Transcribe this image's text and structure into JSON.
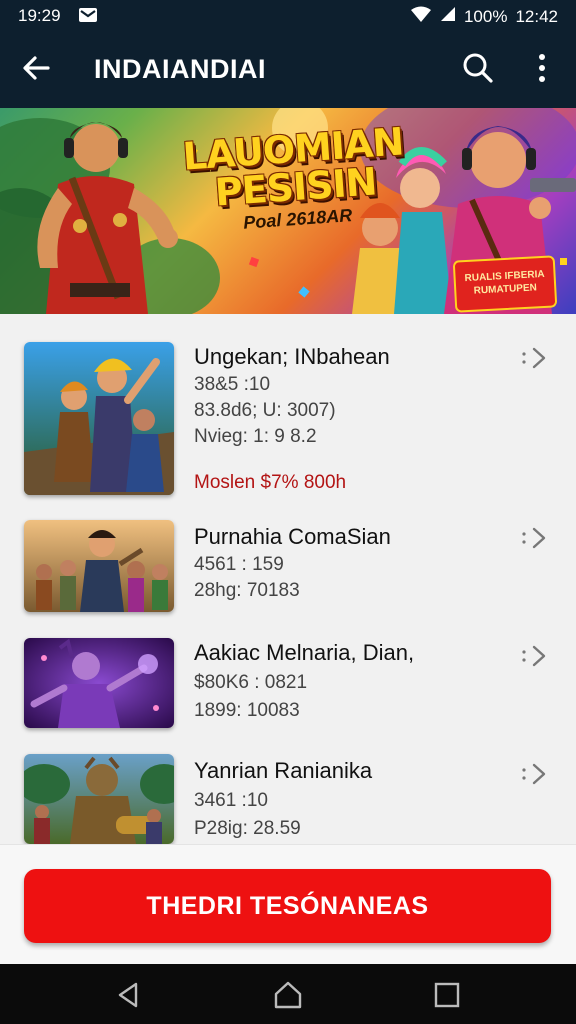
{
  "status_bar": {
    "time_left": "19:29",
    "battery": "100%",
    "time_right": "12:42"
  },
  "app_bar": {
    "title": "INDAIANDIAI"
  },
  "banner": {
    "headline_line1": "LAUOMIAN",
    "headline_line2": "PESISIN",
    "subtitle": "Poal 2618AR",
    "badge_line1": "RUALIS IFBERIA",
    "badge_line2": "RUMATUPEN"
  },
  "games": [
    {
      "name": "Ungekan; INbahean",
      "meta": [
        "38&5 :10",
        "83.8d6; U: 3007)",
        "Nvieg: 1: 9 8.2"
      ],
      "promo": "Moslen $7% 800h",
      "art": "heroes"
    },
    {
      "name": "Purnahia ComaSian",
      "meta": [
        "4561 : 159",
        "28hg: 70183"
      ],
      "art": "warriors"
    },
    {
      "name": "Aakiac Melnaria, Dian,",
      "meta": [
        "$80K6 : 0821",
        "1899: 10083"
      ],
      "art": "purple"
    },
    {
      "name": "Yanrian Ranianika",
      "meta": [
        "3461 :10",
        "P28ig: 28.59"
      ],
      "art": "golem"
    }
  ],
  "cta": {
    "label": "THEDRI TESÓNANEAS"
  },
  "colors": {
    "accent": "#ee1111",
    "appbar": "#0d1f2e",
    "promo": "#b31414"
  }
}
